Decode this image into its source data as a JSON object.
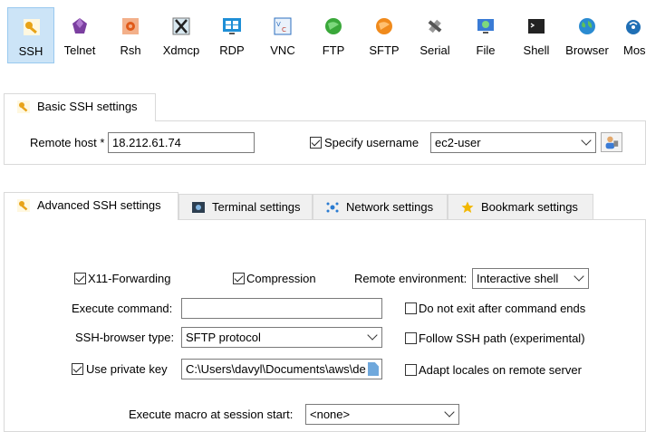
{
  "toolbar": {
    "items": [
      {
        "label": "SSH",
        "icon": "key-icon",
        "color": "#e8a317"
      },
      {
        "label": "Telnet",
        "icon": "gem-icon",
        "color": "#7b3fa0"
      },
      {
        "label": "Rsh",
        "icon": "gear-icon",
        "color": "#e05a1a"
      },
      {
        "label": "Xdmcp",
        "icon": "x-icon",
        "color": "#222222"
      },
      {
        "label": "RDP",
        "icon": "windows-icon",
        "color": "#1f8fd6"
      },
      {
        "label": "VNC",
        "icon": "vnc-icon",
        "color": "#2c6fbf"
      },
      {
        "label": "FTP",
        "icon": "globe-icon",
        "color": "#3aa83a"
      },
      {
        "label": "SFTP",
        "icon": "globe-icon",
        "color": "#f08a1c"
      },
      {
        "label": "Serial",
        "icon": "satellite-icon",
        "color": "#777777"
      },
      {
        "label": "File",
        "icon": "monitor-icon",
        "color": "#3a7bd5"
      },
      {
        "label": "Shell",
        "icon": "terminal-icon",
        "color": "#222222"
      },
      {
        "label": "Browser",
        "icon": "earth-icon",
        "color": "#2a8bd1"
      },
      {
        "label": "Mos",
        "icon": "antenna-icon",
        "color": "#1f6fb5"
      }
    ]
  },
  "basic": {
    "tab_label": "Basic SSH settings",
    "remote_host_label": "Remote host *",
    "remote_host_value": "18.212.61.74",
    "specify_username_label": "Specify username",
    "username_value": "ec2-user"
  },
  "advanced": {
    "tabs": [
      {
        "label": "Advanced SSH settings"
      },
      {
        "label": "Terminal settings"
      },
      {
        "label": "Network settings"
      },
      {
        "label": "Bookmark settings"
      }
    ],
    "x11_label": "X11-Forwarding",
    "compression_label": "Compression",
    "remote_env_label": "Remote environment:",
    "remote_env_value": "Interactive shell",
    "execute_command_label": "Execute command:",
    "execute_command_value": "",
    "do_not_exit_label": "Do not exit after command ends",
    "browser_type_label": "SSH-browser type:",
    "browser_type_value": "SFTP protocol",
    "follow_path_label": "Follow SSH path (experimental)",
    "private_key_label": "Use private key",
    "private_key_value": "C:\\Users\\davyl\\Documents\\aws\\de",
    "adapt_locales_label": "Adapt locales on remote server",
    "macro_label": "Execute macro at session start:",
    "macro_value": "<none>"
  }
}
